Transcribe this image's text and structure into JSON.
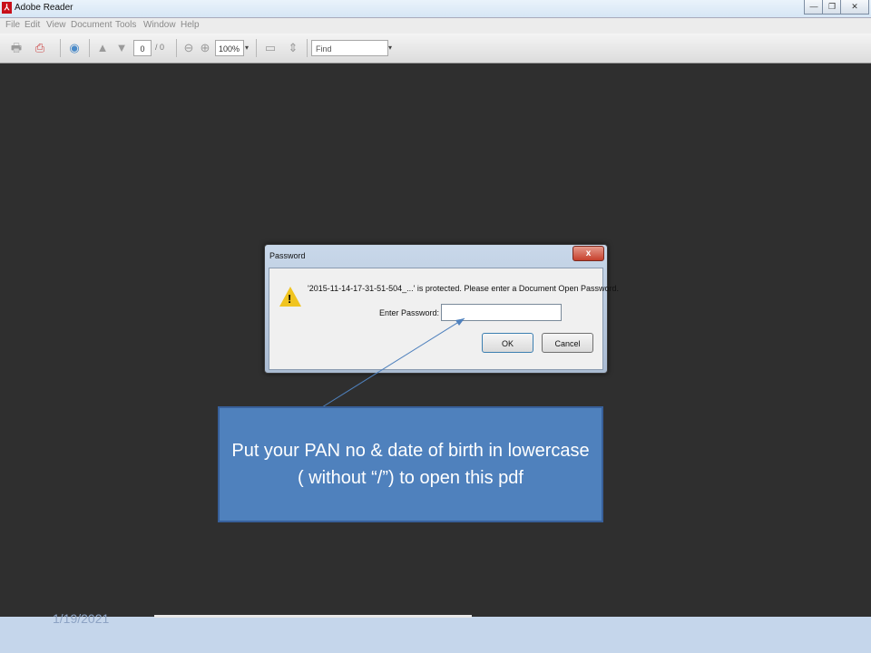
{
  "window": {
    "title": "Adobe Reader"
  },
  "menu": [
    "File",
    "Edit",
    "View",
    "Document",
    "Tools",
    "Window",
    "Help"
  ],
  "toolbar": {
    "page_current": "0",
    "page_total": "/ 0",
    "zoom": "100%",
    "find_placeholder": "Find"
  },
  "dialog": {
    "title": "Password",
    "close_label": "x",
    "message": "'2015-11-14-17-31-51-504_...' is protected. Please enter a Document Open Password.",
    "password_label": "Enter Password:",
    "password_value": "",
    "ok_label": "OK",
    "cancel_label": "Cancel"
  },
  "callout": {
    "text": "Put your PAN no & date of birth in lowercase ( without “/”) to open this pdf"
  },
  "slide": {
    "date": "1/19/2021"
  },
  "colors": {
    "callout_bg": "#4f81bd",
    "app_bg": "#2f2f2f"
  }
}
